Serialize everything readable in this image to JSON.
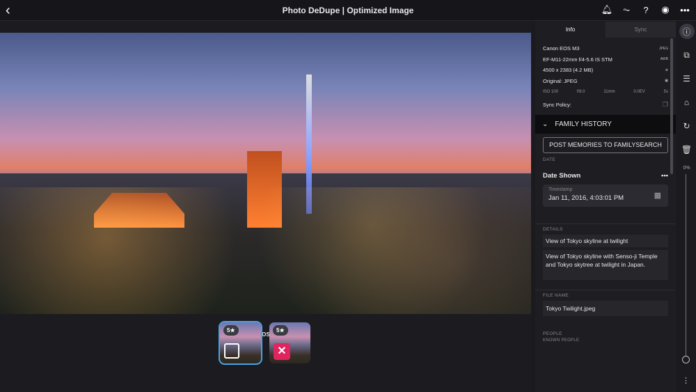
{
  "header": {
    "title": "Photo DeDupe | Optimized Image"
  },
  "icons": {
    "back": "chevron-left-icon",
    "notifications": "bell-icon",
    "activity": "activity-icon",
    "help": "help-icon",
    "account": "account-icon",
    "more": "more-icon"
  },
  "viewer": {
    "mark_label": "MARK PHOTOS TO DELETE",
    "thumbs": [
      {
        "rating": "5★",
        "marked": false,
        "selected": true
      },
      {
        "rating": "5★",
        "marked": true,
        "selected": false
      }
    ]
  },
  "panel": {
    "tabs": [
      "Info",
      "Sync"
    ],
    "meta": [
      {
        "text": "Canon EOS M3",
        "badge": "JPEG"
      },
      {
        "text": "EF-M11-22mm f/4-5.6 IS STM",
        "badge": "AWB"
      },
      {
        "text": "4500 x 2383 (4.2 MB)",
        "badge": "⊗"
      },
      {
        "text": "Original: JPEG",
        "badge": "▣"
      }
    ],
    "exif": [
      "ISO 100",
      "f/8.0",
      "11mm",
      "0.0EV",
      "5s"
    ],
    "sync_policy": "Sync Policy:",
    "family_history": "FAMILY HISTORY",
    "post_button": "POST MEMORIES TO FAMILYSEARCH",
    "date_label": "DATE",
    "date_shown": "Date Shown",
    "timestamp_label": "Timestamp",
    "timestamp": "Jan 11, 2016, 4:03:01 PM",
    "details_label": "DETAILS",
    "title_value": "View of Tokyo skyline at twilight",
    "description": "View of Tokyo skyline with Senso-ji Temple and Tokyo skytree at twilight in Japan.",
    "file_name_label": "FILE NAME",
    "file_name": "Tokyo Twilight.jpeg",
    "people_label": "PEOPLE",
    "known_people_label": "KNOWN PEOPLE"
  },
  "rail": {
    "zoom": "0%"
  }
}
